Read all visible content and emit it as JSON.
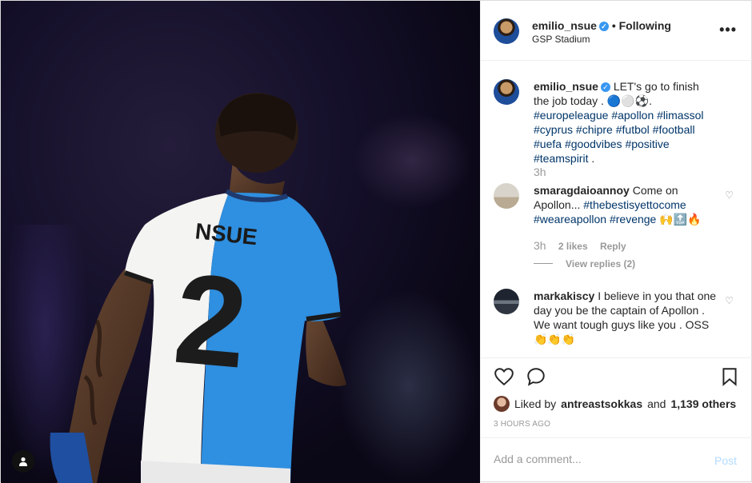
{
  "post": {
    "username": "emilio_nsue",
    "following": "• Following",
    "location": "GSP Stadium",
    "caption_user": "emilio_nsue",
    "caption_text": "LET's go to finish the job today .",
    "caption_emoji": "🔵⚪⚽.",
    "caption_tags": [
      "#europeleague",
      "#apollon",
      "#limassol",
      "#cyprus",
      "#chipre",
      "#futbol",
      "#football",
      "#uefa",
      "#goodvibes",
      "#positive",
      "#teamspirit"
    ],
    "caption_end": ".",
    "caption_time": "3h",
    "jersey_name": "NSUE",
    "jersey_number": "2"
  },
  "comments": [
    {
      "username": "smaragdaioannoy",
      "text": "Come on Apollon...",
      "tags": [
        "#thebestisyettocome",
        "#weareapollon",
        "#revenge"
      ],
      "emoji": "🙌🔝🔥",
      "time": "3h",
      "likes": "2 likes",
      "reply": "Reply",
      "view_replies": "View replies (2)"
    },
    {
      "username": "markakiscy",
      "text": "I believe in you that one day you be the captain of Apollon . We want tough guys like you . OSS",
      "emoji": "👏👏👏"
    }
  ],
  "likes": {
    "prefix": "Liked by",
    "user": "antreastsokkas",
    "and": "and",
    "others": "1,139 others"
  },
  "timestamp": "3 HOURS AGO",
  "add_comment": {
    "placeholder": "Add a comment...",
    "post_label": "Post"
  },
  "icons": {
    "verified": "verified-badge-icon",
    "heart": "heart-icon",
    "comment": "comment-icon",
    "save": "bookmark-icon",
    "more": "more-options-icon",
    "user_tag": "user-tag-icon"
  },
  "colors": {
    "verified": "#3897f0",
    "hashtag": "#003569",
    "post_disabled": "#b3dbff",
    "jersey_blue": "#2f8fe0"
  }
}
